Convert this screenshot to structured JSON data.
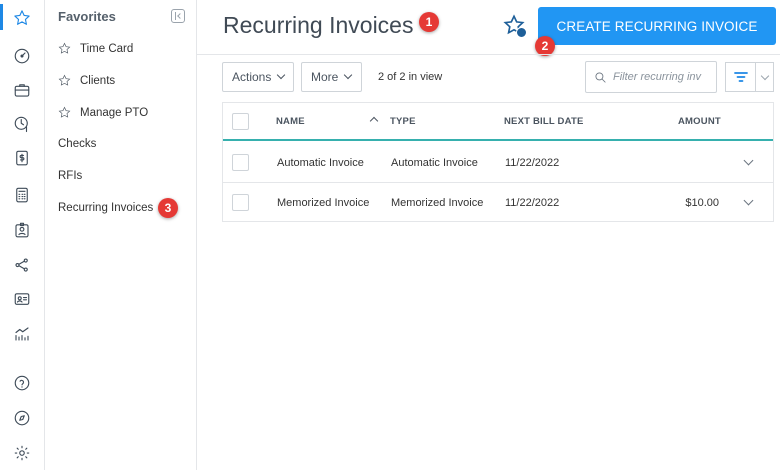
{
  "rail": {
    "icons": [
      "star-icon",
      "dashboard-icon",
      "briefcase-icon",
      "clock-money-icon",
      "dollar-doc-icon",
      "calculator-icon",
      "id-badge-icon",
      "share-icon",
      "contact-card-icon",
      "chart-icon",
      "help-icon",
      "compass-icon",
      "settings-icon"
    ],
    "accent": "#1e88e5"
  },
  "sidenav": {
    "title": "Favorites",
    "favorites": [
      {
        "label": "Time Card"
      },
      {
        "label": "Clients"
      },
      {
        "label": "Manage PTO"
      }
    ],
    "links": [
      {
        "label": "Checks"
      },
      {
        "label": "RFIs"
      },
      {
        "label": "Recurring Invoices"
      }
    ]
  },
  "header": {
    "title": "Recurring Invoices",
    "create_label": "CREATE RECURRING INVOICE",
    "brand_color": "#2196f3"
  },
  "badges": {
    "one": "1",
    "two": "2",
    "three": "3"
  },
  "toolbar": {
    "actions_label": "Actions",
    "more_label": "More",
    "count_text": "2 of 2 in view",
    "search_placeholder": "Filter recurring inv"
  },
  "table": {
    "columns": {
      "name": "NAME",
      "type": "TYPE",
      "next_bill_date": "NEXT BILL DATE",
      "amount": "AMOUNT"
    },
    "rows": [
      {
        "name": "Automatic Invoice",
        "type": "Automatic Invoice",
        "next_bill_date": "11/22/2022",
        "amount": ""
      },
      {
        "name": "Memorized Invoice",
        "type": "Memorized Invoice",
        "next_bill_date": "11/22/2022",
        "amount": "$10.00"
      }
    ],
    "header_underline_color": "#36b0ae"
  }
}
